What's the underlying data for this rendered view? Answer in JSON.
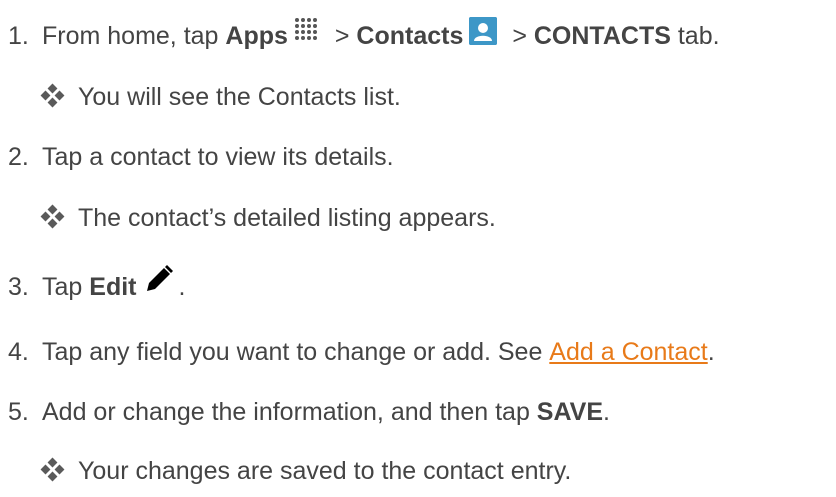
{
  "steps": [
    {
      "number": "1.",
      "text_before": "From home, tap ",
      "apps_label": "Apps",
      "sep1": " > ",
      "contacts_label": "Contacts",
      "sep2": " > ",
      "contacts_tab_label": "CONTACTS",
      "text_after": " tab.",
      "result": "You will see the Contacts list."
    },
    {
      "number": "2.",
      "text": "Tap a contact to view its details.",
      "result": "The contact’s detailed listing appears."
    },
    {
      "number": "3.",
      "text_before": "Tap ",
      "edit_label": "Edit",
      "text_after": "."
    },
    {
      "number": "4.",
      "text_before": "Tap any field you want to change or add. See ",
      "link_text": "Add a Contact",
      "text_after": "."
    },
    {
      "number": "5.",
      "text_before": "Add or change the information, and then tap ",
      "save_label": "SAVE",
      "text_after": ".",
      "result": "Your changes are saved to the contact entry."
    }
  ],
  "icons": {
    "apps": "apps-grid-icon",
    "contacts": "contacts-app-icon",
    "edit": "pencil-edit-icon",
    "bullet": "diamond-bullet-icon"
  },
  "colors": {
    "text": "#444444",
    "link": "#e87a19",
    "contacts_icon": "#3d97c7"
  }
}
